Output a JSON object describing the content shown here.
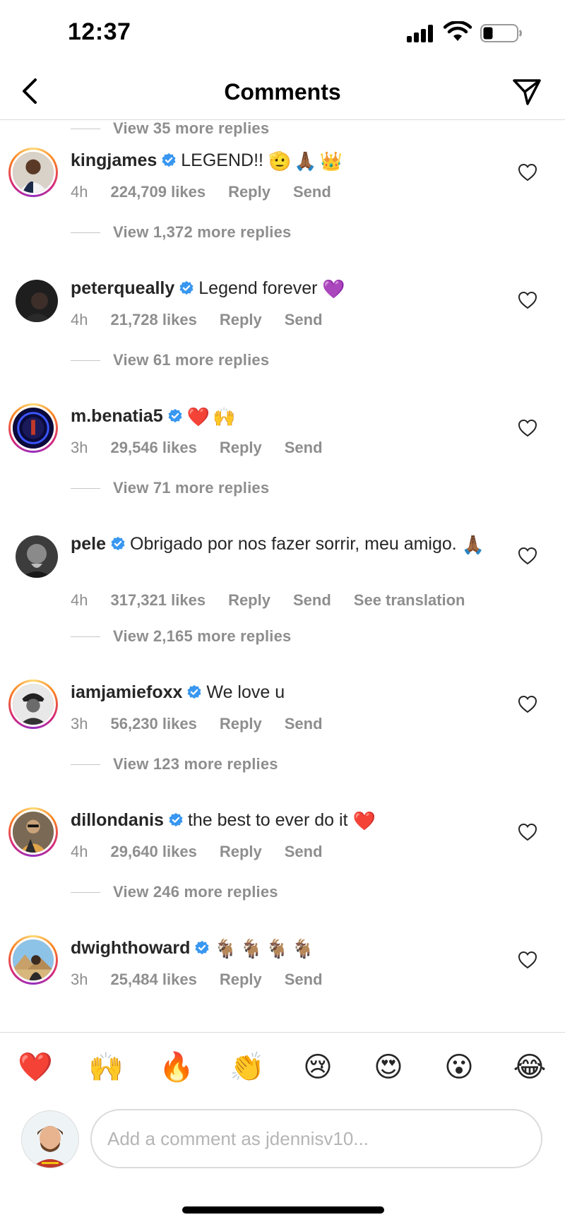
{
  "status_bar": {
    "time": "12:37"
  },
  "header": {
    "title": "Comments",
    "back_icon": "chevron-left-icon",
    "send_icon": "paper-plane-icon"
  },
  "colors": {
    "verified": "#3897f0",
    "meta_text": "#8e8e8e",
    "primary_text": "#262626"
  },
  "comments": {
    "top_replies": "View 35 more replies",
    "items": [
      {
        "username": "kingjames",
        "text": "LEGEND!!",
        "emojis": [
          "🫡",
          "🙏🏾",
          "👑"
        ],
        "time": "4h",
        "likes": "224,709 likes",
        "reply": "Reply",
        "send": "Send",
        "replies": "View 1,372 more replies"
      },
      {
        "username": "peterqueally",
        "text": "Legend forever",
        "emojis": [
          "💜"
        ],
        "time": "4h",
        "likes": "21,728 likes",
        "reply": "Reply",
        "send": "Send",
        "replies": "View 61 more replies"
      },
      {
        "username": "m.benatia5",
        "text": "",
        "emojis": [
          "❤️",
          "🙌"
        ],
        "time": "3h",
        "likes": "29,546 likes",
        "reply": "Reply",
        "send": "Send",
        "replies": "View 71 more replies"
      },
      {
        "username": "pele",
        "text": "Obrigado por nos fazer sorrir, meu amigo.",
        "emojis": [
          "🙏🏾"
        ],
        "time": "4h",
        "likes": "317,321 likes",
        "reply": "Reply",
        "send": "Send",
        "translate": "See translation",
        "replies": "View 2,165 more replies"
      },
      {
        "username": "iamjamiefoxx",
        "text": "We love u",
        "emojis": [],
        "time": "3h",
        "likes": "56,230 likes",
        "reply": "Reply",
        "send": "Send",
        "replies": "View 123 more replies"
      },
      {
        "username": "dillondanis",
        "text": "the best to ever do it",
        "emojis": [
          "❤️"
        ],
        "time": "4h",
        "likes": "29,640 likes",
        "reply": "Reply",
        "send": "Send",
        "replies": "View 246 more replies"
      },
      {
        "username": "dwighthoward",
        "text": "",
        "emojis": [
          "🐐",
          "🐐",
          "🐐",
          "🐐"
        ],
        "time": "3h",
        "likes": "25,484 likes",
        "reply": "Reply",
        "send": "Send"
      }
    ]
  },
  "emoji_bar": [
    "❤️",
    "🙌",
    "🔥",
    "👏",
    "😢",
    "😍",
    "😮",
    "😂"
  ],
  "composer": {
    "placeholder": "Add a comment as jdennisv10..."
  }
}
